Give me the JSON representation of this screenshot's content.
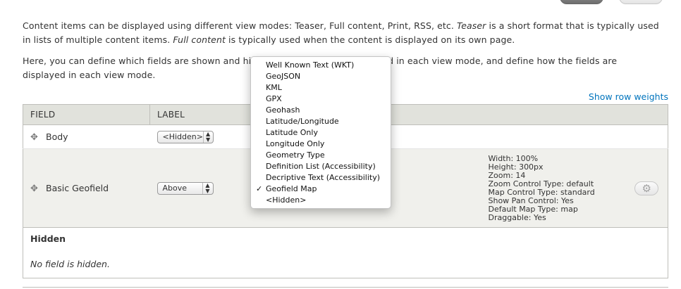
{
  "intro": {
    "p1_a": "Content items can be displayed using different view modes: Teaser, Full content, Print, RSS, etc. ",
    "p1_teaser": "Teaser",
    "p1_b": " is a short format that is typically used in lists of multiple content items. ",
    "p1_full": "Full content",
    "p1_c": " is typically used when the content is displayed on its own page.",
    "p2": "Here, you can define which fields are shown and hidden when content is displayed in each view mode, and define how the fields are displayed in each view mode."
  },
  "show_row_weights": "Show row weights",
  "table": {
    "headers": {
      "field": "FIELD",
      "label": "LABEL"
    },
    "rows": [
      {
        "field": "Body",
        "label_select": "<Hidden>"
      },
      {
        "field": "Basic Geofield",
        "label_select": "Above",
        "summary": [
          "Width: 100%",
          "Height: 300px",
          "Zoom: 14",
          "Zoom Control Type: default",
          "Map Control Type: standard",
          "Show Pan Control: Yes",
          "Default Map Type: map",
          "Draggable: Yes"
        ]
      }
    ],
    "hidden_region": {
      "title": "Hidden",
      "empty_text": "No field is hidden."
    }
  },
  "dropdown": {
    "options": [
      "Well Known Text (WKT)",
      "GeoJSON",
      "KML",
      "GPX",
      "Geohash",
      "Latitude/Longitude",
      "Latitude Only",
      "Longitude Only",
      "Geometry Type",
      "Definition List (Accessibility)",
      "Decriptive Text (Accessibility)",
      "Geofield Map",
      "<Hidden>"
    ],
    "selected": "Geofield Map",
    "check_mark": "✓"
  },
  "icons": {
    "drag": "move-handle-icon",
    "settings": "gear-icon"
  },
  "colors": {
    "link": "#0074bd",
    "header_bg": "#e1e2dc",
    "selected_row_bg": "#f0f0ec"
  }
}
